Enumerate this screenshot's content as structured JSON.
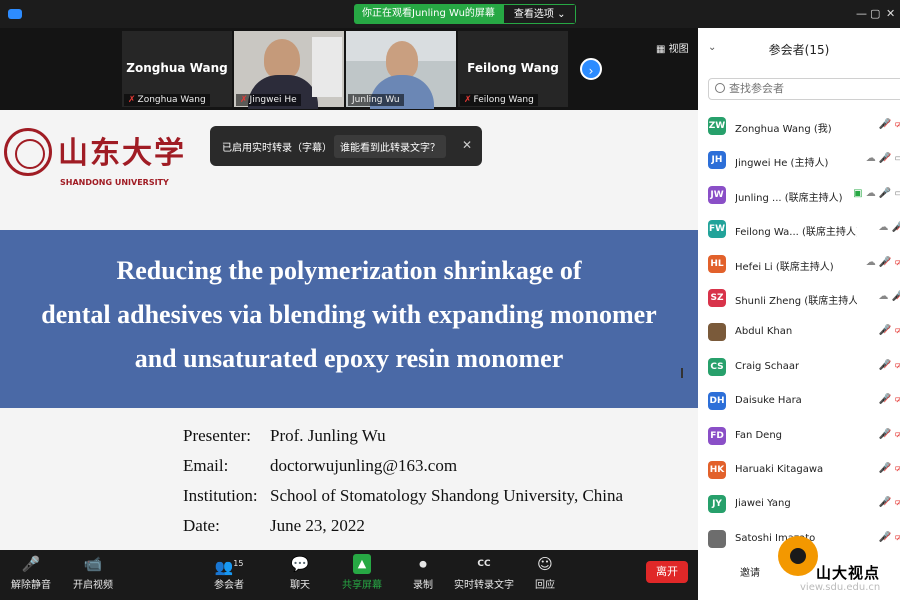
{
  "window": {
    "share_banner": "你正在观看Junling  Wu的屏幕",
    "view_options": "查看选项 ⌄",
    "controls": [
      "—",
      "▢",
      "✕"
    ]
  },
  "video_strip": {
    "tiles": [
      {
        "center_name": "Zonghua Wang",
        "tag": "Zonghua Wang",
        "has_video": false
      },
      {
        "center_name": "",
        "tag": "Jingwei He",
        "has_video": true
      },
      {
        "center_name": "",
        "tag": "Junling Wu",
        "has_video": true
      },
      {
        "center_name": "Feilong Wang",
        "tag": "Feilong Wang",
        "has_video": false
      }
    ],
    "view_label": "▦ 视图"
  },
  "slide": {
    "university_cn": "山东大学",
    "university_en": "SHANDONG UNIVERSITY",
    "title_lines": [
      "Reducing the polymerization shrinkage of",
      "dental adhesives via blending with expanding monomer",
      "and unsaturated epoxy resin monomer"
    ],
    "info": [
      {
        "label": "Presenter:",
        "value": "Prof. Junling Wu"
      },
      {
        "label": "Email:",
        "value": "doctorwujunling@163.com"
      },
      {
        "label": "Institution:",
        "value": "School of Stomatology  Shandong University, China"
      },
      {
        "label": "Date:",
        "value": "June  23, 2022"
      }
    ]
  },
  "caption_bar": {
    "text": "已启用实时转录（字幕）",
    "link": "谁能看到此转录文字？",
    "close": "✕"
  },
  "toolbar": {
    "items": [
      {
        "label": "解除静音",
        "icon": "🎤"
      },
      {
        "label": "开启视频",
        "icon": "📹"
      },
      {
        "label": "参会者",
        "icon": "👥",
        "count": "15"
      },
      {
        "label": "聊天",
        "icon": "💬"
      },
      {
        "label": "共享屏幕",
        "icon": "▲"
      },
      {
        "label": "录制",
        "icon": "⏺"
      },
      {
        "label": "实时转录文字",
        "icon": "CC"
      },
      {
        "label": "回应",
        "icon": "☺"
      }
    ],
    "leave": "离开"
  },
  "panel": {
    "title": "参会者(15)",
    "search_placeholder": "查找参会者",
    "invite": "邀请",
    "participants": [
      {
        "initials": "ZW",
        "name": "Zonghua Wang (我)",
        "color": "#27a06b"
      },
      {
        "initials": "JH",
        "name": "Jingwei He (主持人)",
        "color": "#2d6fd8"
      },
      {
        "initials": "JW",
        "name": "Junling ... (联席主持人)",
        "color": "#8a4fc7"
      },
      {
        "initials": "FW",
        "name": "Feilong Wa... (联席主持人)",
        "color": "#22a39a"
      },
      {
        "initials": "HL",
        "name": "Hefei Li (联席主持人)",
        "color": "#e2612b"
      },
      {
        "initials": "SZ",
        "name": "Shunli Zheng (联席主持人)",
        "color": "#d8334a"
      },
      {
        "initials": "",
        "name": "Abdul Khan",
        "color": "#7a5a3a"
      },
      {
        "initials": "CS",
        "name": "Craig Schaar",
        "color": "#27a06b"
      },
      {
        "initials": "DH",
        "name": "Daisuke Hara",
        "color": "#2d6fd8"
      },
      {
        "initials": "FD",
        "name": "Fan Deng",
        "color": "#8a4fc7"
      },
      {
        "initials": "HK",
        "name": "Haruaki Kitagawa",
        "color": "#e2612b"
      },
      {
        "initials": "JY",
        "name": "Jiawei Yang",
        "color": "#27a06b"
      },
      {
        "initials": "",
        "name": "Satoshi Imazato",
        "color": "#6d6d6d"
      }
    ]
  },
  "watermark": {
    "cn": "山大视点",
    "url": "view.sdu.edu.cn"
  }
}
